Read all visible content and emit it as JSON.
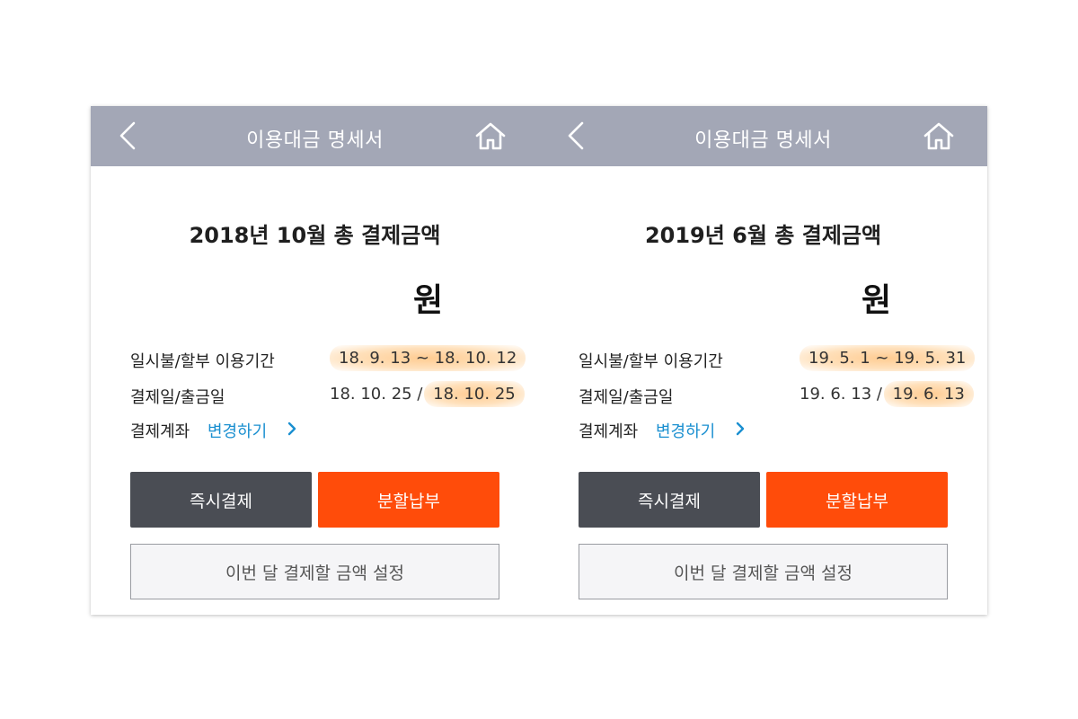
{
  "colors": {
    "header_bg": "#a3a7b6",
    "dark_button": "#4a4d54",
    "orange_button": "#ff4c0a",
    "link": "#1a8fd0",
    "highlight": "#ffc98c"
  },
  "screens": [
    {
      "header": {
        "title": "이용대금 명세서",
        "back_icon": "chevron-left-icon",
        "home_icon": "home-icon"
      },
      "heading": "2018년 10월 총 결제금액",
      "currency": "원",
      "period_label": "일시불/할부 이용기간",
      "period_value": "18. 9. 13 ~ 18. 10. 12",
      "date_label": "결제일/출금일",
      "payment_date": "18. 10. 25 /",
      "withdraw_date": "18. 10. 25",
      "account_label": "결제계좌",
      "change_link": "변경하기",
      "btn_instant": "즉시결제",
      "btn_installment": "분할납부",
      "btn_set_amount": "이번 달 결제할 금액 설정"
    },
    {
      "header": {
        "title": "이용대금 명세서",
        "back_icon": "chevron-left-icon",
        "home_icon": "home-icon"
      },
      "heading": "2019년 6월 총 결제금액",
      "currency": "원",
      "period_label": "일시불/할부 이용기간",
      "period_value": "19. 5. 1 ~ 19. 5. 31",
      "date_label": "결제일/출금일",
      "payment_date": "19. 6. 13 /",
      "withdraw_date": "19. 6. 13",
      "account_label": "결제계좌",
      "change_link": "변경하기",
      "btn_instant": "즉시결제",
      "btn_installment": "분할납부",
      "btn_set_amount": "이번 달 결제할 금액 설정"
    }
  ]
}
